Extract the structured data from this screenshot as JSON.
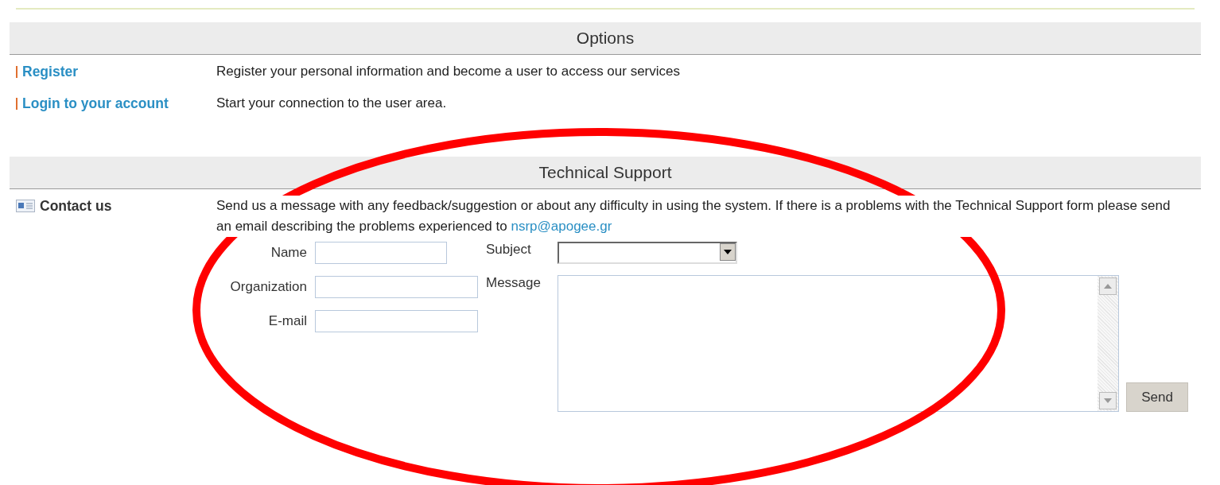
{
  "sections": [
    {
      "title": "Options",
      "items": [
        {
          "kind": "link",
          "label": "Register",
          "description": "Register your personal information and become a user to access our services"
        },
        {
          "kind": "link",
          "label": "Login to your account",
          "description": "Start your connection to the user area."
        }
      ]
    },
    {
      "title": "Technical Support",
      "items": [
        {
          "kind": "contact",
          "label": "Contact us",
          "description": "Send us a message with any feedback/suggestion or about any difficulty in using the system. If there is a problems with the Technical Support form please send an email describing the problems experienced to ",
          "email": "nsrp@apogee.gr",
          "form": {
            "fields": [
              {
                "label": "Name",
                "kind": "short"
              },
              {
                "label": "Organization",
                "kind": "long"
              },
              {
                "label": "E-mail",
                "kind": "long"
              }
            ],
            "subject_label": "Subject",
            "message_label": "Message",
            "send": "Send"
          }
        }
      ]
    }
  ],
  "annotation": {
    "kind": "ellipse",
    "color": "#ff0000"
  }
}
